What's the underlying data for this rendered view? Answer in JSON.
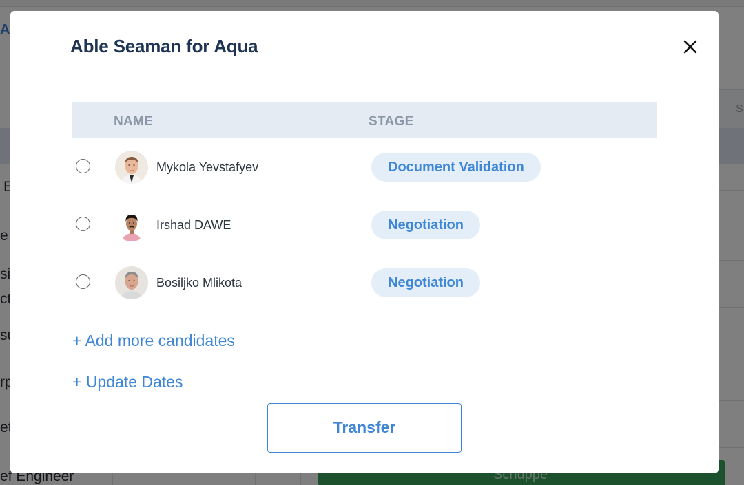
{
  "background": {
    "blue_link_fragment": "Au",
    "header_letter": "S",
    "row_fragments": [
      "E",
      "e",
      "si",
      "ct",
      "su",
      "rp",
      "et"
    ],
    "bottom_label": "ef Engineer",
    "green_button_text": "Schuppe"
  },
  "modal": {
    "title": "Able Seaman for Aqua",
    "close_icon": "close-icon",
    "table": {
      "headers": {
        "name": "NAME",
        "stage": "STAGE"
      },
      "rows": [
        {
          "name": "Mykola Yevstafyev",
          "stage": "Document Validation",
          "selected": false
        },
        {
          "name": "Irshad DAWE",
          "stage": "Negotiation",
          "selected": false
        },
        {
          "name": "Bosiljko Mlikota",
          "stage": "Negotiation",
          "selected": false
        }
      ]
    },
    "add_candidates_label": "+ Add more candidates",
    "update_dates_label": "+ Update Dates",
    "transfer_label": "Transfer"
  },
  "colors": {
    "title": "#1f3452",
    "accent": "#3f87d6",
    "stage_bg": "#e3eef9",
    "table_header_bg": "#e4ebf3",
    "header_text": "#8b97a8",
    "background_green": "#3aa35c"
  }
}
